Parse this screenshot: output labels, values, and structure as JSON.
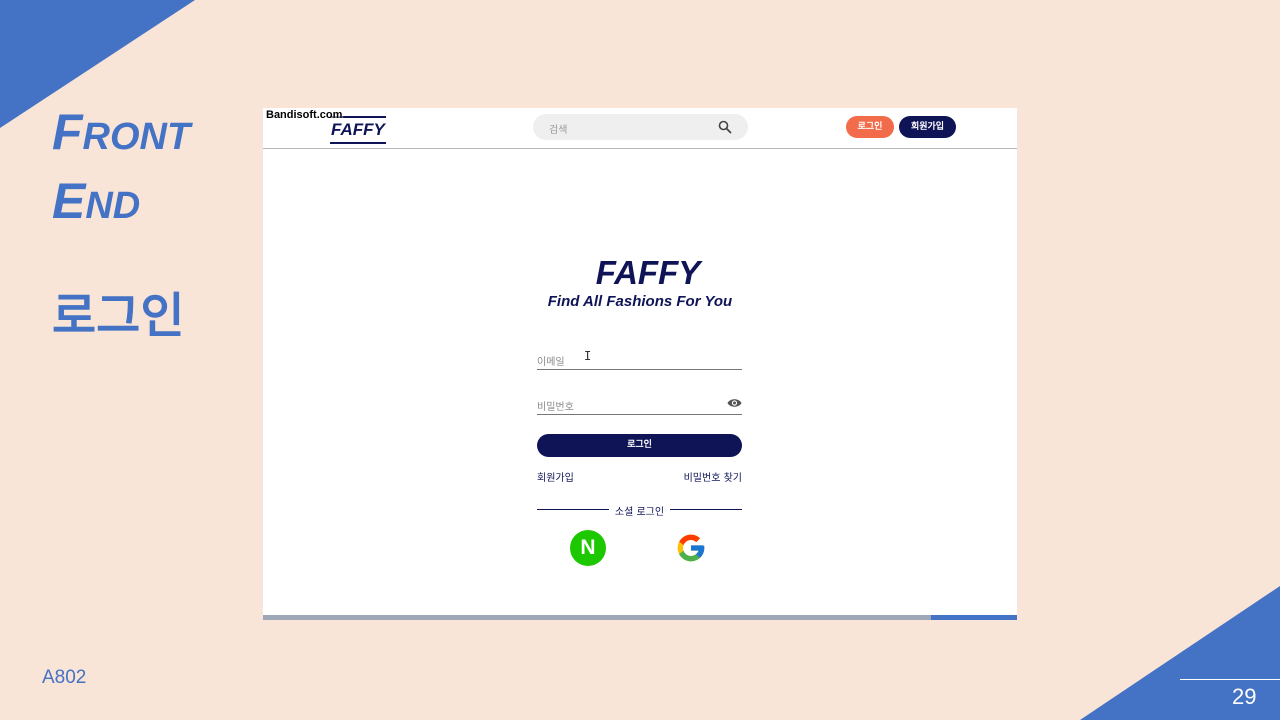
{
  "slide": {
    "title_line1_first": "F",
    "title_line1_rest": "RONT",
    "title_line2_first": "E",
    "title_line2_rest": "ND",
    "subtitle": "로그인",
    "footer_code": "A802",
    "page_number": "29",
    "accent_color": "#4472c4",
    "background_color": "#f9e4d8"
  },
  "screenshot": {
    "watermark": "Bandisoft.com",
    "nav": {
      "logo": "FAFFY",
      "search_placeholder": "검색",
      "login_label": "로그인",
      "signup_label": "회원가입"
    },
    "brand": {
      "name": "FAFFY",
      "tagline": "Find All Fashions For You"
    },
    "form": {
      "email_placeholder": "이메일",
      "password_placeholder": "비밀번호",
      "submit_label": "로그인",
      "signup_link": "회원가입",
      "find_password_link": "비밀번호 찾기",
      "social_divider": "소셜 로그인",
      "naver_letter": "N"
    },
    "colors": {
      "navy": "#0f1457",
      "orange": "#f26b4a",
      "naver_green": "#1ec800"
    }
  }
}
